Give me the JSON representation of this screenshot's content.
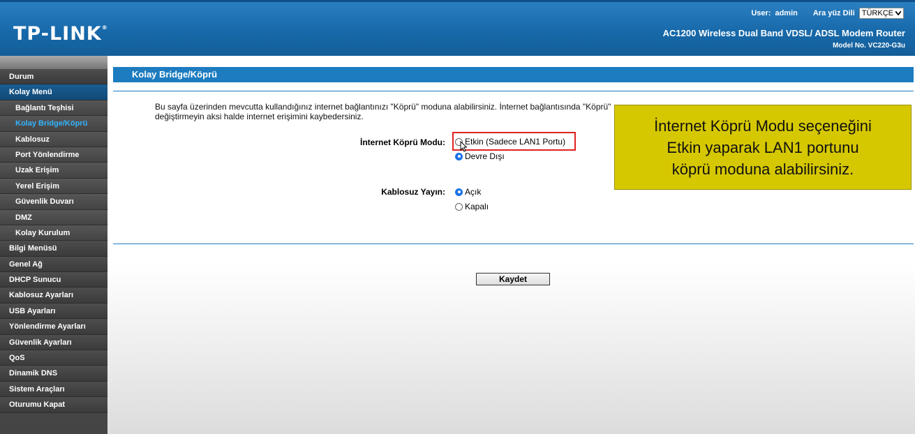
{
  "header": {
    "logo": "TP-LINK",
    "user_label": "User:",
    "user_name": "admin",
    "lang_label": "Ara yüz Dili",
    "lang_value": "TÜRKÇE",
    "product": "AC1200 Wireless Dual Band VDSL/ ADSL Modem Router",
    "model": "Model No. VC220-G3u"
  },
  "sidebar": {
    "items": [
      {
        "label": "Durum"
      },
      {
        "label": "Kolay Menü"
      },
      {
        "label": "Bağlantı Teşhisi"
      },
      {
        "label": "Kolay Bridge/Köprü"
      },
      {
        "label": "Kablosuz"
      },
      {
        "label": "Port Yönlendirme"
      },
      {
        "label": "Uzak Erişim"
      },
      {
        "label": "Yerel Erişim"
      },
      {
        "label": "Güvenlik Duvarı"
      },
      {
        "label": "DMZ"
      },
      {
        "label": "Kolay Kurulum"
      },
      {
        "label": "Bilgi Menüsü"
      },
      {
        "label": "Genel Ağ"
      },
      {
        "label": "DHCP Sunucu"
      },
      {
        "label": "Kablosuz Ayarları"
      },
      {
        "label": "USB Ayarları"
      },
      {
        "label": "Yönlendirme Ayarları"
      },
      {
        "label": "Güvenlik Ayarları"
      },
      {
        "label": "QoS"
      },
      {
        "label": "Dinamik DNS"
      },
      {
        "label": "Sistem Araçları"
      },
      {
        "label": "Oturumu Kapat"
      }
    ]
  },
  "main": {
    "title": "Kolay Bridge/Köprü",
    "description_line1": "Bu sayfa üzerinden mevcutta kullandığınız internet bağlantınızı \"Köprü\" moduna alabilirsiniz. İnternet bağlantısında \"Köprü\"",
    "description_line2": "değiştirmeyin aksi halde internet erişimini kaybedersiniz.",
    "bridge_mode": {
      "label": "İnternet Köprü Modu:",
      "option_enabled": "Etkin (Sadece LAN1 Portu)",
      "option_disabled": "Devre Dışı",
      "selected": "Devre Dışı"
    },
    "wireless": {
      "label": "Kablosuz Yayın:",
      "option_on": "Açık",
      "option_off": "Kapalı",
      "selected": "Açık"
    },
    "save_label": "Kaydet"
  },
  "callout": {
    "line1": "İnternet Köprü Modu seçeneğini",
    "line2": "Etkin yaparak LAN1 portunu",
    "line3": "köprü moduna alabilirsiniz."
  },
  "colors": {
    "header_blue": "#1769aa",
    "accent_blue": "#1d7cc0",
    "callout_yellow": "#d6c800",
    "highlight_red": "#e02020",
    "current_menu": "#33b4ff"
  }
}
